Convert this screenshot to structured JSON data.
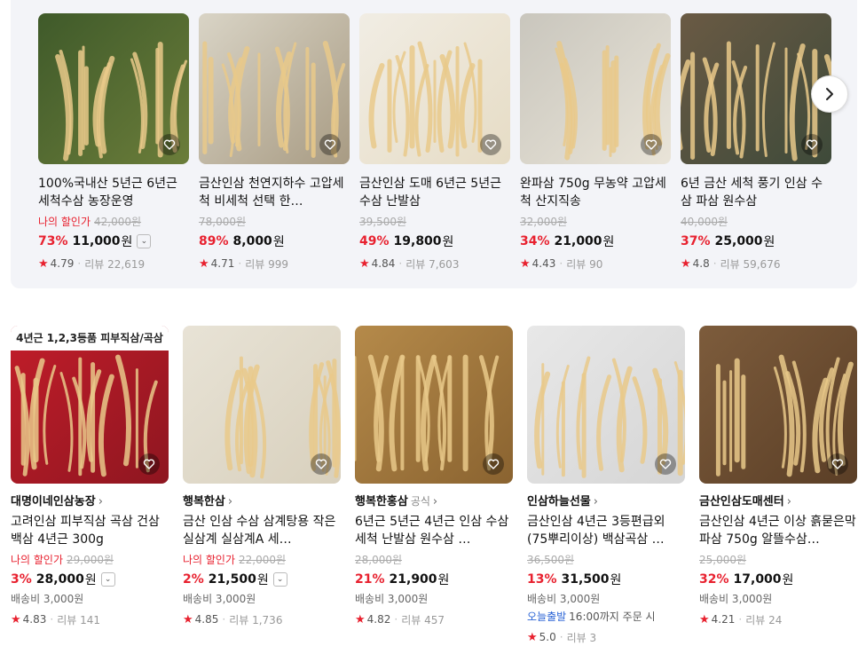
{
  "colors": {
    "accent": "#e8212f",
    "delivery": "#2b64d6"
  },
  "carousel": {
    "next_icon": "chevron-right-icon"
  },
  "top_products": [
    {
      "title": "100%국내산 5년근 6년근 세척수삼 농장운영",
      "my_discount": "나의 할인가",
      "original_price": "42,000원",
      "discount": "73%",
      "price": "11,000",
      "won": "원",
      "has_dropdown": true,
      "rating": "4.79",
      "reviews": "리뷰 22,619"
    },
    {
      "title": "금산인삼 천연지하수 고압세척 비세척 선택 한…",
      "my_discount": "",
      "original_price": "78,000원",
      "discount": "89%",
      "price": "8,000",
      "won": "원",
      "has_dropdown": false,
      "rating": "4.71",
      "reviews": "리뷰 999"
    },
    {
      "title": "금산인삼 도매 6년근 5년근 수삼 난발삼",
      "my_discount": "",
      "original_price": "39,500원",
      "discount": "49%",
      "price": "19,800",
      "won": "원",
      "has_dropdown": false,
      "rating": "4.84",
      "reviews": "리뷰 7,603"
    },
    {
      "title": "완파삼 750g 무농약 고압세척 산지직송",
      "my_discount": "",
      "original_price": "32,000원",
      "discount": "34%",
      "price": "21,000",
      "won": "원",
      "has_dropdown": false,
      "rating": "4.43",
      "reviews": "리뷰 90"
    },
    {
      "title": "6년 금산 세척 풍기 인삼 수삼 파삼 원수삼",
      "my_discount": "",
      "original_price": "40,000원",
      "discount": "37%",
      "price": "25,000",
      "won": "원",
      "has_dropdown": false,
      "rating": "4.8",
      "reviews": "리뷰 59,676"
    }
  ],
  "bottom_products": [
    {
      "banner": "4년근 1,2,3등품 피부직삼/곡삼",
      "store": "대명이네인삼농장",
      "official": "",
      "title": "고려인삼 피부직삼 곡삼 건삼 백삼 4년근 300g",
      "my_discount": "나의 할인가",
      "original_price": "29,000원",
      "discount": "3%",
      "price": "28,000",
      "won": "원",
      "has_dropdown": true,
      "shipping": "배송비 3,000원",
      "delivery_label": "",
      "delivery_text": "",
      "rating": "4.83",
      "reviews": "리뷰 141"
    },
    {
      "banner": "",
      "store": "행복한삼",
      "official": "",
      "title": "금산 인삼 수삼 삼계탕용 작은 실삼계 실삼계A 세…",
      "my_discount": "나의 할인가",
      "original_price": "22,000원",
      "discount": "2%",
      "price": "21,500",
      "won": "원",
      "has_dropdown": true,
      "shipping": "배송비 3,000원",
      "delivery_label": "",
      "delivery_text": "",
      "rating": "4.85",
      "reviews": "리뷰 1,736"
    },
    {
      "banner": "",
      "store": "행복한홍삼",
      "official": "공식",
      "title": "6년근 5년근 4년근 인삼 수삼 세척 난발삼 원수삼 …",
      "my_discount": "",
      "original_price": "28,000원",
      "discount": "21%",
      "price": "21,900",
      "won": "원",
      "has_dropdown": false,
      "shipping": "배송비 3,000원",
      "delivery_label": "",
      "delivery_text": "",
      "rating": "4.82",
      "reviews": "리뷰 457"
    },
    {
      "banner": "",
      "store": "인삼하늘선물",
      "official": "",
      "title": "금산인삼 4년근 3등편급외(75뿌리이상) 백삼곡삼 …",
      "my_discount": "",
      "original_price": "36,500원",
      "discount": "13%",
      "price": "31,500",
      "won": "원",
      "has_dropdown": false,
      "shipping": "배송비 3,000원",
      "delivery_label": "오늘출발",
      "delivery_text": "16:00까지 주문 시",
      "rating": "5.0",
      "reviews": "리뷰 3"
    },
    {
      "banner": "",
      "store": "금산인삼도매센터",
      "official": "",
      "title": "금산인삼 4년근 이상 흙묻은막파삼 750g 알뜰수삼…",
      "my_discount": "",
      "original_price": "25,000원",
      "discount": "32%",
      "price": "17,000",
      "won": "원",
      "has_dropdown": false,
      "shipping": "배송비 3,000원",
      "delivery_label": "",
      "delivery_text": "",
      "rating": "4.21",
      "reviews": "리뷰 24"
    }
  ]
}
